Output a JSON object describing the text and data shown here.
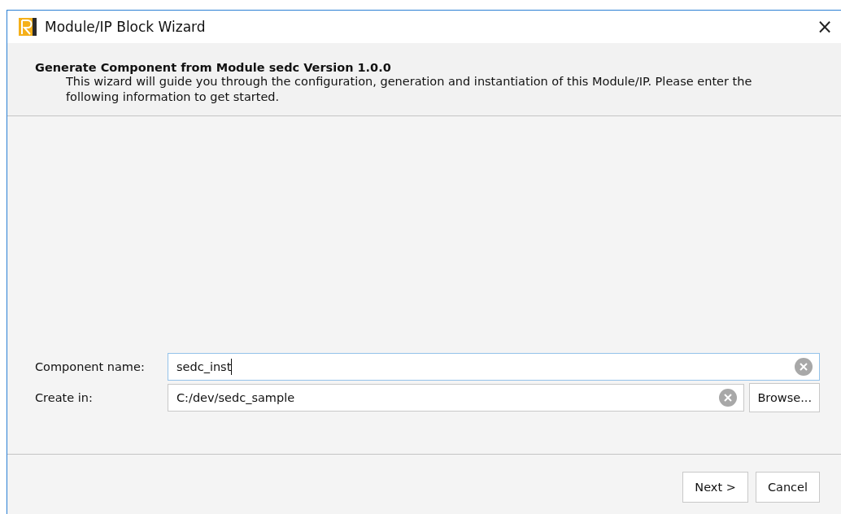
{
  "window": {
    "title": "Module/IP Block Wizard",
    "close": "×"
  },
  "header": {
    "title": "Generate Component from Module sedc Version 1.0.0",
    "description": "This wizard will guide you through the configuration, generation and instantiation of this Module/IP. Please enter the following information to get started."
  },
  "fields": [
    {
      "label": "Component name:",
      "value": "sedc_inst",
      "focused": true
    },
    {
      "label": "Create in:",
      "value": "C:/dev/sedc_sample",
      "focused": false,
      "button": "Browse..."
    }
  ],
  "buttons": [
    "Next >",
    "Cancel"
  ]
}
